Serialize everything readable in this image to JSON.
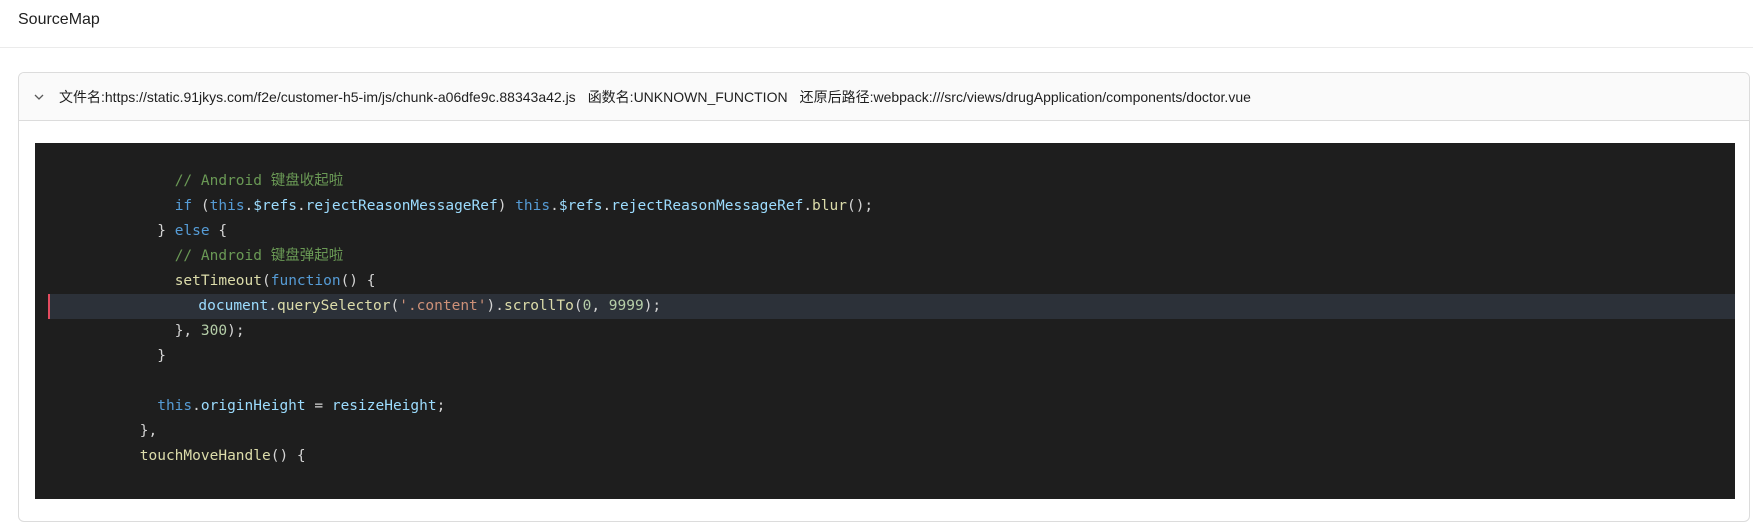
{
  "header": {
    "title": "SourceMap"
  },
  "panel": {
    "file_label": "文件名:https://static.91jkys.com/f2e/customer-h5-im/js/chunk-a06dfe9c.88343a42.js",
    "function_label": "函数名:UNKNOWN_FUNCTION",
    "restored_path_label": "还原后路径:webpack:///src/views/drugApplication/components/doctor.vue",
    "expanded": true
  },
  "code": {
    "highlighted_line": 6,
    "lines": [
      {
        "indent": "          ",
        "tokens": [
          {
            "c": "cmt",
            "t": "// Android 键盘收起啦"
          }
        ]
      },
      {
        "indent": "          ",
        "tokens": [
          {
            "c": "kw",
            "t": "if"
          },
          {
            "c": "pun",
            "t": " ("
          },
          {
            "c": "kw",
            "t": "this"
          },
          {
            "c": "pun",
            "t": "."
          },
          {
            "c": "var",
            "t": "$refs"
          },
          {
            "c": "pun",
            "t": "."
          },
          {
            "c": "var",
            "t": "rejectReasonMessageRef"
          },
          {
            "c": "pun",
            "t": ") "
          },
          {
            "c": "kw",
            "t": "this"
          },
          {
            "c": "pun",
            "t": "."
          },
          {
            "c": "var",
            "t": "$refs"
          },
          {
            "c": "pun",
            "t": "."
          },
          {
            "c": "var",
            "t": "rejectReasonMessageRef"
          },
          {
            "c": "pun",
            "t": "."
          },
          {
            "c": "fn",
            "t": "blur"
          },
          {
            "c": "pun",
            "t": "();"
          }
        ]
      },
      {
        "indent": "        ",
        "tokens": [
          {
            "c": "pun",
            "t": "} "
          },
          {
            "c": "kw",
            "t": "else"
          },
          {
            "c": "pun",
            "t": " {"
          }
        ]
      },
      {
        "indent": "          ",
        "tokens": [
          {
            "c": "cmt",
            "t": "// Android 键盘弹起啦"
          }
        ]
      },
      {
        "indent": "          ",
        "tokens": [
          {
            "c": "fn",
            "t": "setTimeout"
          },
          {
            "c": "pun",
            "t": "("
          },
          {
            "c": "kw",
            "t": "function"
          },
          {
            "c": "pun",
            "t": "() {"
          }
        ]
      },
      {
        "indent": "            ",
        "tokens": [
          {
            "c": "var",
            "t": "document"
          },
          {
            "c": "pun",
            "t": "."
          },
          {
            "c": "fn",
            "t": "querySelector"
          },
          {
            "c": "pun",
            "t": "("
          },
          {
            "c": "str",
            "t": "'.content'"
          },
          {
            "c": "pun",
            "t": ")."
          },
          {
            "c": "fn",
            "t": "scrollTo"
          },
          {
            "c": "pun",
            "t": "("
          },
          {
            "c": "num",
            "t": "0"
          },
          {
            "c": "pun",
            "t": ", "
          },
          {
            "c": "num",
            "t": "9999"
          },
          {
            "c": "pun",
            "t": ");"
          }
        ]
      },
      {
        "indent": "          ",
        "tokens": [
          {
            "c": "pun",
            "t": "}, "
          },
          {
            "c": "num",
            "t": "300"
          },
          {
            "c": "pun",
            "t": ");"
          }
        ]
      },
      {
        "indent": "        ",
        "tokens": [
          {
            "c": "pun",
            "t": "}"
          }
        ]
      },
      {
        "indent": "",
        "tokens": []
      },
      {
        "indent": "        ",
        "tokens": [
          {
            "c": "kw",
            "t": "this"
          },
          {
            "c": "pun",
            "t": "."
          },
          {
            "c": "var",
            "t": "originHeight"
          },
          {
            "c": "pun",
            "t": " = "
          },
          {
            "c": "var",
            "t": "resizeHeight"
          },
          {
            "c": "pun",
            "t": ";"
          }
        ]
      },
      {
        "indent": "      ",
        "tokens": [
          {
            "c": "pun",
            "t": "},"
          }
        ]
      },
      {
        "indent": "      ",
        "tokens": [
          {
            "c": "fn",
            "t": "touchMoveHandle"
          },
          {
            "c": "pun",
            "t": "() {"
          }
        ]
      }
    ]
  }
}
